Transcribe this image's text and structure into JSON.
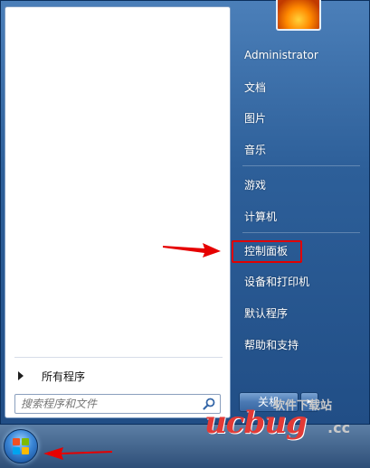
{
  "start_menu": {
    "all_programs_label": "所有程序",
    "search_placeholder": "搜索程序和文件",
    "user_name": "Administrator",
    "right_items": [
      {
        "label": "Administrator"
      },
      {
        "label": "文档"
      },
      {
        "label": "图片"
      },
      {
        "label": "音乐"
      },
      {
        "label": "游戏"
      },
      {
        "label": "计算机"
      },
      {
        "label": "控制面板"
      },
      {
        "label": "设备和打印机"
      },
      {
        "label": "默认程序"
      },
      {
        "label": "帮助和支持"
      }
    ],
    "highlighted_item": "控制面板",
    "shutdown_label": "关机",
    "shutdown_arrow": "▸"
  },
  "watermark": {
    "main": "ucbug",
    "top": "软件下载站",
    "suffix": ".cc"
  },
  "colors": {
    "highlight_border": "#e10000",
    "annotation_arrow": "#e60000",
    "menu_blue": "#2d5f99"
  },
  "icons": {
    "search": "search-icon",
    "start": "windows-start-orb-icon",
    "user": "user-picture-flower"
  }
}
